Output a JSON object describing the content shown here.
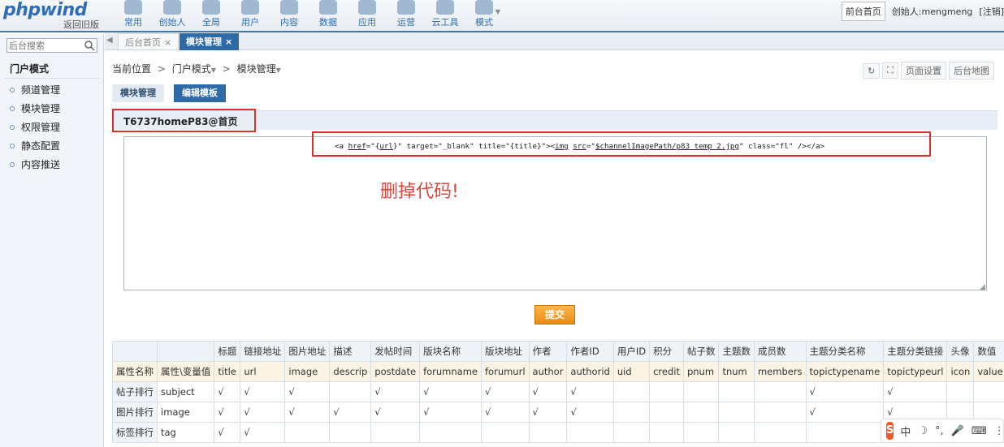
{
  "header": {
    "logo": "phpwind",
    "old_version": "返回旧版",
    "nav": [
      {
        "label": "常用",
        "icon": "star-icon"
      },
      {
        "label": "创始人",
        "icon": "founder-icon"
      },
      {
        "label": "全局",
        "icon": "globe-icon"
      },
      {
        "label": "用户",
        "icon": "users-icon"
      },
      {
        "label": "内容",
        "icon": "chat-icon"
      },
      {
        "label": "数据",
        "icon": "database-icon"
      },
      {
        "label": "应用",
        "icon": "wrench-icon"
      },
      {
        "label": "运营",
        "icon": "monitor-icon"
      },
      {
        "label": "云工具",
        "icon": "cloud-icon"
      },
      {
        "label": "模式",
        "icon": "gear-icon"
      }
    ],
    "front_home": "前台首页",
    "founder": "创始人:mengmeng",
    "logout": "[注销]"
  },
  "sidebar": {
    "search_placeholder": "后台搜索",
    "title": "门户模式",
    "items": [
      "频道管理",
      "模块管理",
      "权限管理",
      "静态配置",
      "内容推送"
    ]
  },
  "tabs": [
    {
      "label": "后台首页",
      "close": "×"
    },
    {
      "label": "模块管理",
      "close": "×"
    }
  ],
  "breadcrumb": {
    "prefix": "当前位置",
    "sep": ">",
    "items": [
      "门户模式",
      "模块管理"
    ]
  },
  "tools": {
    "page_settings": "页面设置",
    "site_map": "后台地图"
  },
  "subtabs": [
    "模块管理",
    "编辑模板"
  ],
  "module": {
    "title": "T6737homeP83@首页",
    "code_pre": "<a ",
    "code_href": "href",
    "code_mid1": "=\"{",
    "code_url": "url",
    "code_mid2": "}\"  target=\"_blank\" title=\"{title}\"><",
    "code_img": "img",
    "code_sp": " ",
    "code_src": "src",
    "code_mid3": "=\"",
    "code_path": "$channelImagePath/p83_temp_2.jpg",
    "code_post": "\" class=\"fl\" /></a>",
    "annotation": "删掉代码!",
    "submit": "提交"
  },
  "attr_table": {
    "header": [
      "",
      "",
      "标题",
      "链接地址",
      "图片地址",
      "描述",
      "发帖时间",
      "版块名称",
      "版块地址",
      "作者",
      "作者ID",
      "用户ID",
      "积分",
      "帖子数",
      "主题数",
      "成员数",
      "主题分类名称",
      "主题分类链接",
      "头像",
      "数值"
    ],
    "fields": [
      "属性名称",
      "属性\\变量值",
      "title",
      "url",
      "image",
      "descrip",
      "postdate",
      "forumname",
      "forumurl",
      "author",
      "authorid",
      "uid",
      "credit",
      "pnum",
      "tnum",
      "members",
      "topictypename",
      "topictypeurl",
      "icon",
      "value"
    ],
    "rows": [
      [
        "帖子排行",
        "subject",
        "√",
        "√",
        "√",
        "",
        "√",
        "√",
        "√",
        "√",
        "√",
        "",
        "",
        "",
        "",
        "",
        "√",
        "√",
        "",
        ""
      ],
      [
        "图片排行",
        "image",
        "√",
        "√",
        "√",
        "√",
        "√",
        "√",
        "√",
        "√",
        "√",
        "",
        "",
        "",
        "",
        "",
        "√",
        "√",
        "",
        ""
      ],
      [
        "标签排行",
        "tag",
        "√",
        "√",
        "",
        "",
        "",
        "",
        "",
        "",
        "",
        "",
        "",
        "",
        "",
        "",
        "",
        "",
        "",
        ""
      ]
    ]
  },
  "ime": {
    "logo": "S",
    "glyphs": [
      "中",
      "☽",
      "°,",
      "🎤",
      "⌨",
      "⋮"
    ]
  },
  "colors": {
    "accent": "#2e6aa8",
    "highlight_box": "#d9302c",
    "submit": "#e88b11"
  }
}
